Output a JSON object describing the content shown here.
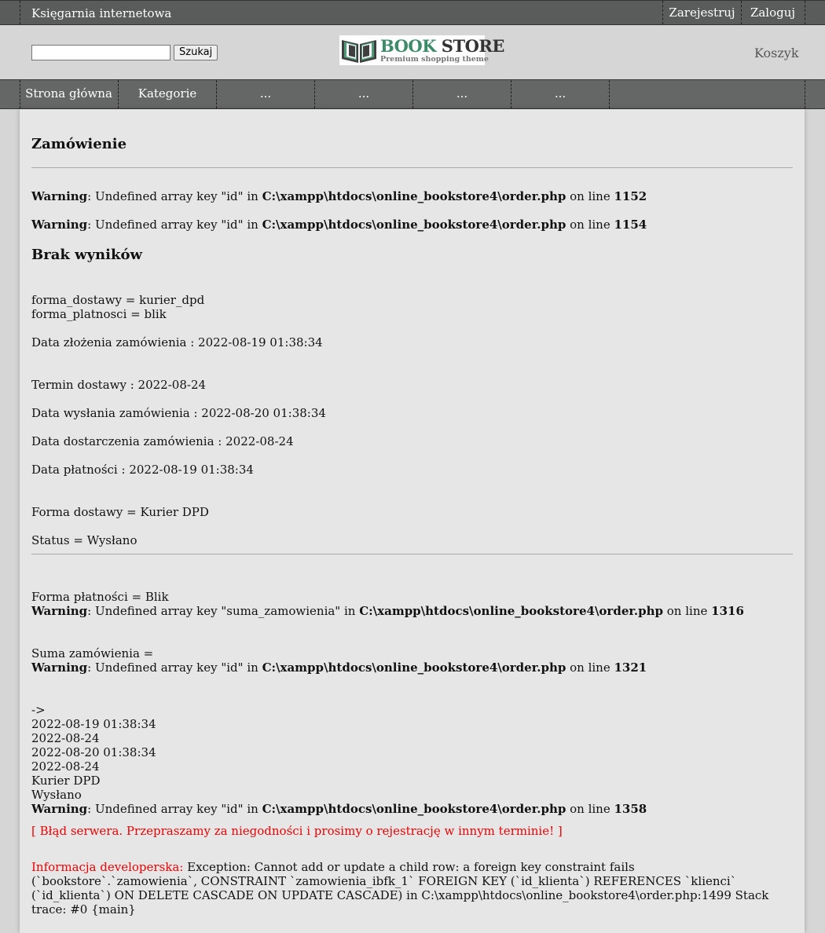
{
  "topbar": {
    "brand": "Księgarnia internetowa",
    "register": "Zarejestruj",
    "login": "Zaloguj"
  },
  "header": {
    "search_button": "Szukaj",
    "search_value": "",
    "logo_title_book": "BOOK",
    "logo_title_store": " STORE",
    "logo_subtitle": "Premium shopping theme",
    "cart": "Koszyk"
  },
  "nav": {
    "items": [
      "Strona główna",
      "Kategorie",
      "...",
      "...",
      "...",
      "..."
    ]
  },
  "main": {
    "title": "Zamówienie",
    "warning_word": "Warning",
    "w1_text": ": Undefined array key \"id\" in ",
    "w1_path": "C:\\xampp\\htdocs\\online_bookstore4\\order.php",
    "w1_online": " on line ",
    "w1_line": "1152",
    "w2_line": "1154",
    "no_results": "Brak wyników",
    "forma_dostawy_raw": "forma_dostawy = kurier_dpd",
    "forma_platnosci_raw": "forma_platnosci = blik",
    "data_zlozenia": "Data złożenia zamówienia : 2022-08-19 01:38:34",
    "termin_dostawy": "Termin dostawy : 2022-08-24",
    "data_wyslania": "Data wysłania zamówienia : 2022-08-20 01:38:34",
    "data_dostarczenia": "Data dostarczenia zamówienia : 2022-08-24",
    "data_platnosci": "Data płatności : 2022-08-19 01:38:34",
    "forma_dostawy": "Forma dostawy = Kurier DPD",
    "status": "Status = Wysłano",
    "forma_platnosci": "Forma płatności = Blik",
    "w3_text": ": Undefined array key \"suma_zamowienia\" in ",
    "w3_line": "1316",
    "suma": "Suma zamówienia =",
    "w4_line": "1321",
    "arrow": "->",
    "list": [
      "2022-08-19 01:38:34",
      "2022-08-24",
      "2022-08-20 01:38:34",
      "2022-08-24",
      "Kurier DPD",
      "Wysłano"
    ],
    "w5_line": "1358",
    "server_error": "[ Błąd serwera. Przepraszamy za niegodności i prosimy o rejestrację w innym terminie! ]",
    "dev_label": "Informacja developerska:",
    "dev_text": " Exception: Cannot add or update a child row: a foreign key constraint fails (`bookstore`.`zamowienia`, CONSTRAINT `zamowienia_ibfk_1` FOREIGN KEY (`id_klienta`) REFERENCES `klienci` (`id_klienta`) ON DELETE CASCADE ON UPDATE CASCADE) in C:\\xampp\\htdocs\\online_bookstore4\\order.php:1499 Stack trace: #0 {main}"
  }
}
